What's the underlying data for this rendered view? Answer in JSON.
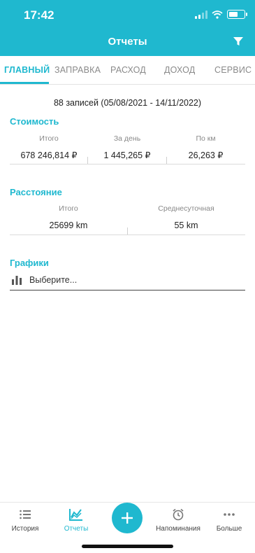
{
  "status_bar": {
    "time": "17:42"
  },
  "header": {
    "title": "Отчеты"
  },
  "tabs": [
    {
      "label": "ГЛАВНЫЙ",
      "active": true
    },
    {
      "label": "ЗАПРАВКА",
      "active": false
    },
    {
      "label": "РАСХОД",
      "active": false
    },
    {
      "label": "ДОХОД",
      "active": false
    },
    {
      "label": "СЕРВИС",
      "active": false
    }
  ],
  "summary": {
    "records": "88 записей (05/08/2021 - 14/11/2022)"
  },
  "cost": {
    "title": "Стоимость",
    "columns": [
      {
        "label": "Итого",
        "value": "678 246,814 ₽"
      },
      {
        "label": "За день",
        "value": "1 445,265 ₽"
      },
      {
        "label": "По км",
        "value": "26,263 ₽"
      }
    ]
  },
  "distance": {
    "title": "Расстояние",
    "columns": [
      {
        "label": "Итого",
        "value": "25699 km"
      },
      {
        "label": "Среднесуточная",
        "value": "55 km"
      }
    ]
  },
  "charts": {
    "title": "Графики",
    "placeholder": "Выберите..."
  },
  "bottom_nav": [
    {
      "label": "История",
      "icon": "list-icon",
      "active": false
    },
    {
      "label": "Отчеты",
      "icon": "chart-icon",
      "active": true
    },
    {
      "label": "Напоминания",
      "icon": "alarm-icon",
      "active": false
    },
    {
      "label": "Больше",
      "icon": "more-icon",
      "active": false
    }
  ],
  "colors": {
    "accent": "#1fb8cf"
  }
}
